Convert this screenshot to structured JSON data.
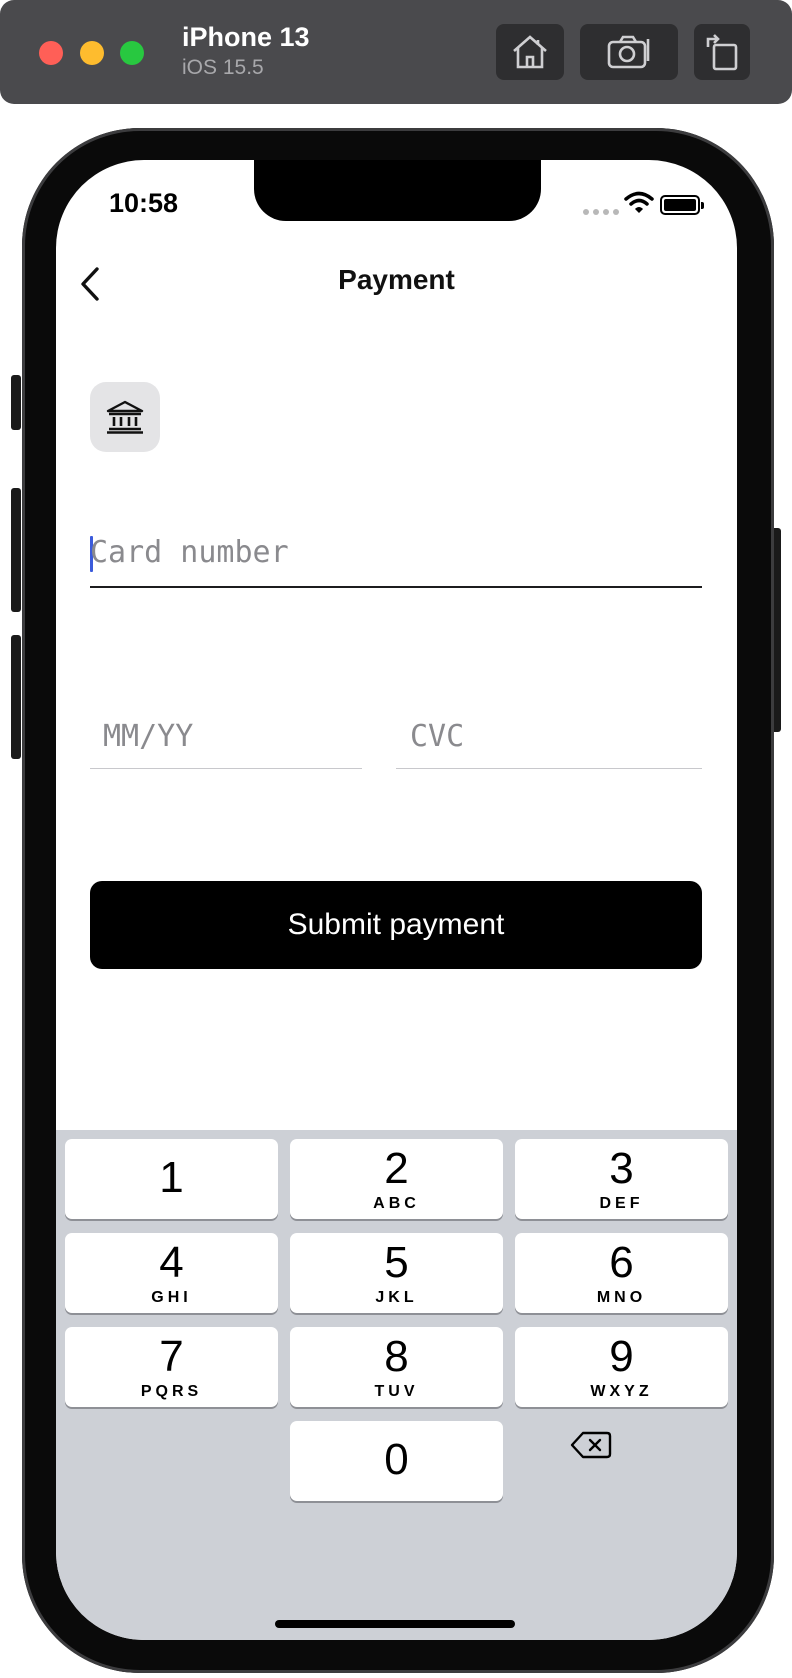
{
  "simulator": {
    "device_name": "iPhone 13",
    "os_version": "iOS 15.5",
    "buttons": [
      "home-icon",
      "screenshot-icon",
      "rotate-icon"
    ]
  },
  "status_bar": {
    "time": "10:58"
  },
  "nav": {
    "title": "Payment",
    "back_icon": "chevron-left-icon"
  },
  "payment_method_icon": "bank-icon",
  "form": {
    "card_number_placeholder": "Card number",
    "expiry_placeholder": "MM/YY",
    "cvc_placeholder": "CVC",
    "submit_label": "Submit payment"
  },
  "keypad": {
    "keys": [
      {
        "digit": "1",
        "letters": ""
      },
      {
        "digit": "2",
        "letters": "ABC"
      },
      {
        "digit": "3",
        "letters": "DEF"
      },
      {
        "digit": "4",
        "letters": "GHI"
      },
      {
        "digit": "5",
        "letters": "JKL"
      },
      {
        "digit": "6",
        "letters": "MNO"
      },
      {
        "digit": "7",
        "letters": "PQRS"
      },
      {
        "digit": "8",
        "letters": "TUV"
      },
      {
        "digit": "9",
        "letters": "WXYZ"
      },
      {
        "digit": "0",
        "letters": ""
      }
    ],
    "delete_icon": "backspace-icon"
  },
  "colors": {
    "caret": "#3b5bdb",
    "submit_bg": "#000000",
    "keypad_bg": "#cdd0d6"
  }
}
